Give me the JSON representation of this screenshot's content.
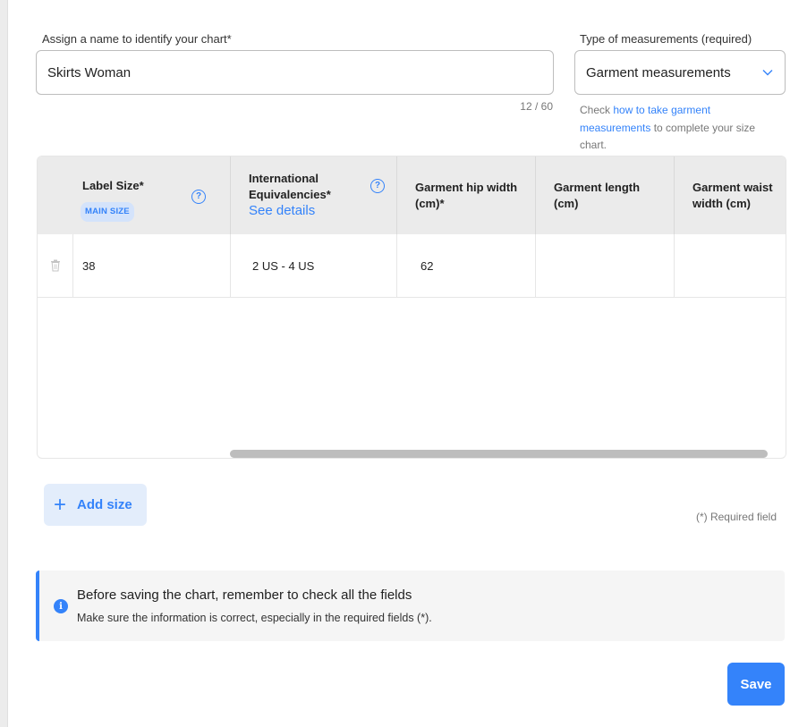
{
  "form": {
    "name_label": "Assign a name to identify your chart*",
    "name_value": "Skirts Woman",
    "name_count": "12 / 60",
    "type_label": "Type of measurements (required)",
    "type_value": "Garment measurements",
    "help_prefix": "Check ",
    "help_link": "how to take garment measurements",
    "help_suffix": " to complete your size chart."
  },
  "table": {
    "columns": {
      "label_size": "Label Size*",
      "main_size_badge": "MAIN SIZE",
      "international": "International Equivalencies*",
      "see_details": "See details",
      "hip_width": "Garment hip width (cm)*",
      "length": "Garment length (cm)",
      "waist_width": "Garment waist width (cm)"
    },
    "rows": [
      {
        "label_size": "38",
        "international": "2 US - 4 US",
        "hip_width": "62",
        "length": "",
        "waist_width": ""
      }
    ]
  },
  "actions": {
    "add_size": "Add size",
    "required_note": "(*) Required field",
    "save": "Save"
  },
  "notice": {
    "title": "Before saving the chart, remember to check all the fields",
    "body": "Make sure the information is correct, especially in the required fields (*)."
  },
  "colors": {
    "accent": "#3483fa",
    "header_bg": "#ebebeb",
    "notice_bg": "#f5f5f5"
  }
}
